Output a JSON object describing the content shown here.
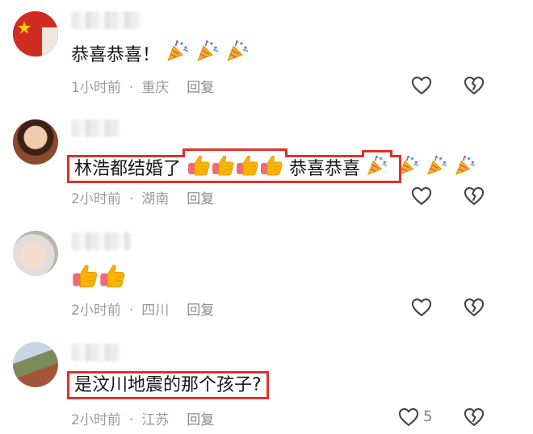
{
  "comments": [
    {
      "text": "恭喜恭喜！",
      "time": "1小时前",
      "location": "重庆",
      "reply": "回复",
      "emoji_trail": [
        "party-popper-emoji",
        "party-popper-emoji",
        "party-popper-emoji"
      ],
      "highlighted": false
    },
    {
      "text_before": "林浩都结婚了",
      "text_after": "恭喜恭喜",
      "time": "2小时前",
      "location": "湖南",
      "reply": "回复",
      "thumbs": 4,
      "highlighted": true
    },
    {
      "time": "2小时前",
      "location": "四川",
      "reply": "回复",
      "thumbs": 2,
      "highlighted": false
    },
    {
      "text": "是汶川地震的那个孩子?",
      "time": "2小时前",
      "location": "江苏",
      "reply": "回复",
      "like_count": "5",
      "highlighted": true
    }
  ],
  "separator": "·",
  "colors": {
    "highlight_border": "#e0302e",
    "meta_text": "#9a9a9a",
    "thumb_yellow": "#f7b500",
    "sleeve_pink": "#ef6a7a"
  },
  "icons": [
    "heart-outline-icon",
    "broken-heart-outline-icon",
    "party-popper-emoji",
    "thumbs-up-emoji"
  ]
}
